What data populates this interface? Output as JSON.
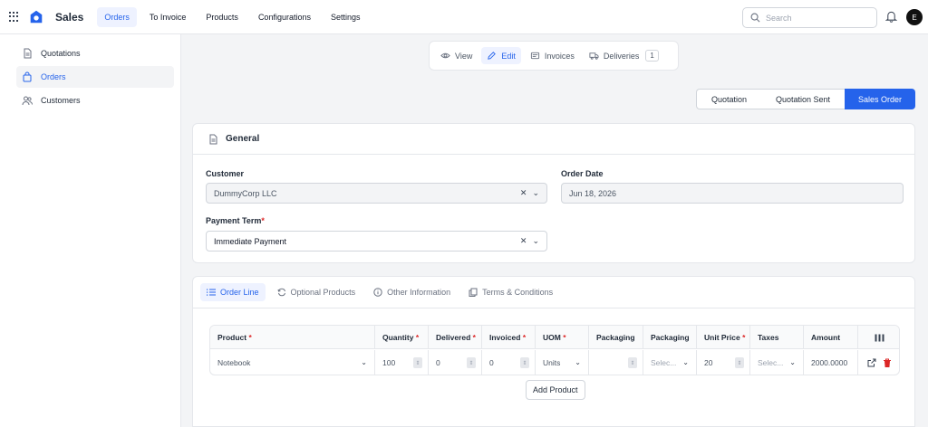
{
  "app": {
    "name": "Sales"
  },
  "nav": {
    "items": [
      "Orders",
      "To Invoice",
      "Products",
      "Configurations",
      "Settings"
    ]
  },
  "search": {
    "placeholder": "Search"
  },
  "user": {
    "initial": "E"
  },
  "sidebar": {
    "items": [
      "Quotations",
      "Orders",
      "Customers"
    ]
  },
  "actions": {
    "view": "View",
    "edit": "Edit",
    "invoices": "Invoices",
    "deliveries": "Deliveries",
    "deliveries_count": "1"
  },
  "stages": [
    "Quotation",
    "Quotation Sent",
    "Sales Order"
  ],
  "general": {
    "title": "General",
    "customer_label": "Customer",
    "customer_value": "DummyCorp LLC",
    "order_date_label": "Order Date",
    "order_date_value": "Jun 18, 2026",
    "payment_term_label": "Payment Term",
    "payment_term_value": "Immediate Payment"
  },
  "lines": {
    "tabs": [
      "Order Line",
      "Optional Products",
      "Other Information",
      "Terms & Conditions"
    ],
    "columns": [
      "Product",
      "Quantity",
      "Delivered",
      "Invoiced",
      "UOM",
      "Packaging",
      "Packaging",
      "Unit Price",
      "Taxes",
      "Amount"
    ],
    "row": {
      "product": "Notebook",
      "quantity": "100",
      "delivered": "0",
      "invoiced": "0",
      "uom": "Units",
      "packaging_qty": "",
      "packaging": "Selec...",
      "unit_price": "20",
      "taxes": "Selec...",
      "amount": "2000.0000"
    },
    "add_product": "Add Product"
  },
  "colors": {
    "accent": "#2563eb",
    "danger": "#dc2626"
  }
}
